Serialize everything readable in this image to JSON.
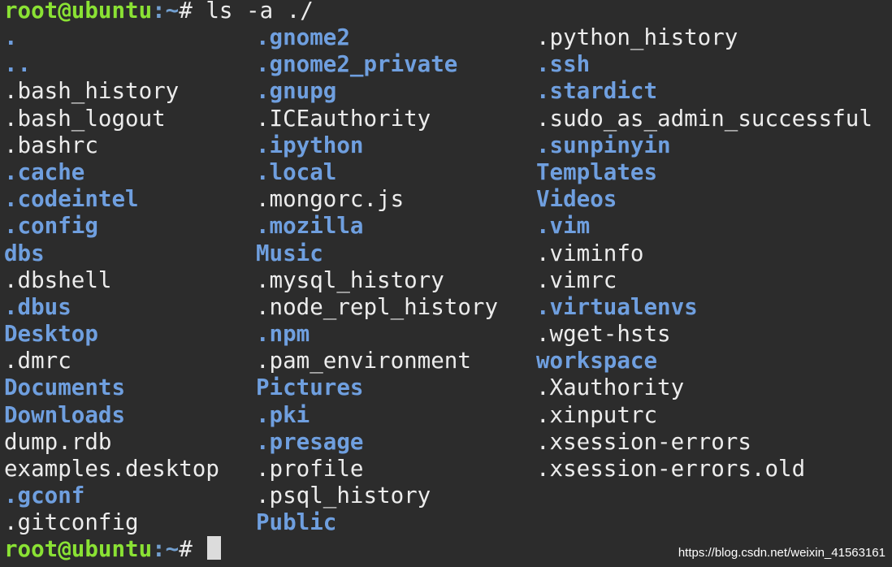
{
  "prompt": {
    "user_host": "root@ubuntu",
    "path": ":~",
    "symbol": "#"
  },
  "command": " ls -a ./",
  "columns": [
    [
      {
        "name": ".",
        "type": "dir"
      },
      {
        "name": "..",
        "type": "dir"
      },
      {
        "name": ".bash_history",
        "type": "file"
      },
      {
        "name": ".bash_logout",
        "type": "file"
      },
      {
        "name": ".bashrc",
        "type": "file"
      },
      {
        "name": ".cache",
        "type": "dir"
      },
      {
        "name": ".codeintel",
        "type": "dir"
      },
      {
        "name": ".config",
        "type": "dir"
      },
      {
        "name": "dbs",
        "type": "dir"
      },
      {
        "name": ".dbshell",
        "type": "file"
      },
      {
        "name": ".dbus",
        "type": "dir"
      },
      {
        "name": "Desktop",
        "type": "dir"
      },
      {
        "name": ".dmrc",
        "type": "file"
      },
      {
        "name": "Documents",
        "type": "dir"
      },
      {
        "name": "Downloads",
        "type": "dir"
      },
      {
        "name": "dump.rdb",
        "type": "file"
      },
      {
        "name": "examples.desktop",
        "type": "file"
      },
      {
        "name": ".gconf",
        "type": "dir"
      },
      {
        "name": ".gitconfig",
        "type": "file"
      }
    ],
    [
      {
        "name": ".gnome2",
        "type": "dir"
      },
      {
        "name": ".gnome2_private",
        "type": "dir"
      },
      {
        "name": ".gnupg",
        "type": "dir"
      },
      {
        "name": ".ICEauthority",
        "type": "file"
      },
      {
        "name": ".ipython",
        "type": "dir"
      },
      {
        "name": ".local",
        "type": "dir"
      },
      {
        "name": ".mongorc.js",
        "type": "file"
      },
      {
        "name": ".mozilla",
        "type": "dir"
      },
      {
        "name": "Music",
        "type": "dir"
      },
      {
        "name": ".mysql_history",
        "type": "file"
      },
      {
        "name": ".node_repl_history",
        "type": "file"
      },
      {
        "name": ".npm",
        "type": "dir"
      },
      {
        "name": ".pam_environment",
        "type": "file"
      },
      {
        "name": "Pictures",
        "type": "dir"
      },
      {
        "name": ".pki",
        "type": "dir"
      },
      {
        "name": ".presage",
        "type": "dir"
      },
      {
        "name": ".profile",
        "type": "file"
      },
      {
        "name": ".psql_history",
        "type": "file"
      },
      {
        "name": "Public",
        "type": "dir"
      }
    ],
    [
      {
        "name": ".python_history",
        "type": "file"
      },
      {
        "name": ".ssh",
        "type": "dir"
      },
      {
        "name": ".stardict",
        "type": "dir"
      },
      {
        "name": ".sudo_as_admin_successful",
        "type": "file"
      },
      {
        "name": ".sunpinyin",
        "type": "dir"
      },
      {
        "name": "Templates",
        "type": "dir"
      },
      {
        "name": "Videos",
        "type": "dir"
      },
      {
        "name": ".vim",
        "type": "dir"
      },
      {
        "name": ".viminfo",
        "type": "file"
      },
      {
        "name": ".vimrc",
        "type": "file"
      },
      {
        "name": ".virtualenvs",
        "type": "dir"
      },
      {
        "name": ".wget-hsts",
        "type": "file"
      },
      {
        "name": "workspace",
        "type": "dir"
      },
      {
        "name": ".Xauthority",
        "type": "file"
      },
      {
        "name": ".xinputrc",
        "type": "file"
      },
      {
        "name": ".xsession-errors",
        "type": "file"
      },
      {
        "name": ".xsession-errors.old",
        "type": "file"
      }
    ]
  ],
  "colors": {
    "prompt_user": "#8ae234",
    "prompt_path": "#729fcf",
    "dir": "#6f9fdf",
    "file": "#ececec",
    "background": "#2c2c2c"
  },
  "watermark": "https://blog.csdn.net/weixin_41563161"
}
